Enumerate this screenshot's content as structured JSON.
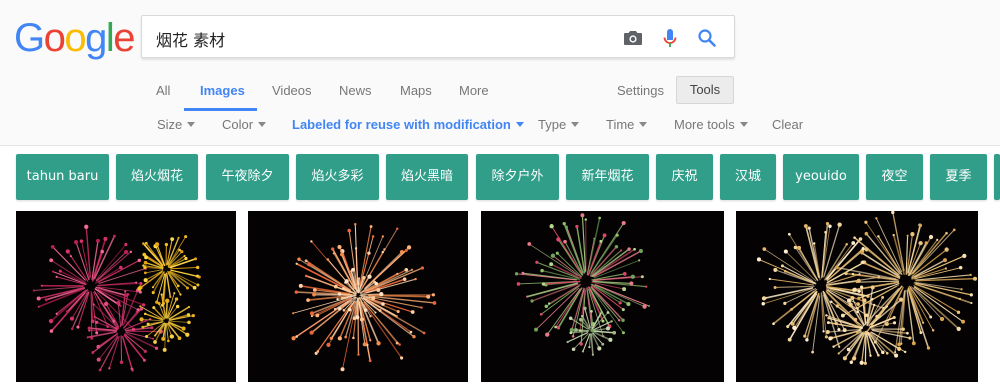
{
  "logo": {
    "letters": [
      "G",
      "o",
      "o",
      "g",
      "l",
      "e"
    ],
    "colors": [
      "#4285f4",
      "#ea4335",
      "#fbbc05",
      "#4285f4",
      "#34a853",
      "#ea4335"
    ]
  },
  "search": {
    "query": "烟花 素材"
  },
  "icons": {
    "camera": "camera-icon",
    "mic": "microphone-icon",
    "search": "search-icon"
  },
  "tabs": {
    "items": [
      "All",
      "Images",
      "Videos",
      "News",
      "Maps",
      "More"
    ],
    "active": "Images",
    "settings": "Settings",
    "tools": "Tools"
  },
  "filters": {
    "size": "Size",
    "color": "Color",
    "usage": "Labeled for reuse with modification",
    "type": "Type",
    "time": "Time",
    "more_tools": "More tools",
    "clear": "Clear"
  },
  "chips": [
    "tahun baru",
    "焰火烟花",
    "午夜除夕",
    "焰火多彩",
    "焰火黑暗",
    "除夕户外",
    "新年烟花",
    "庆祝",
    "汉城",
    "yeouido",
    "夜空",
    "夏季"
  ],
  "results": [
    {
      "description": "pink and gold fireworks"
    },
    {
      "description": "orange peony firework"
    },
    {
      "description": "green and red firework"
    },
    {
      "description": "golden willow fireworks"
    }
  ],
  "colors": {
    "accent": "#4285f4",
    "chip_bg": "#319e8a",
    "header_bg": "#fafafa"
  }
}
